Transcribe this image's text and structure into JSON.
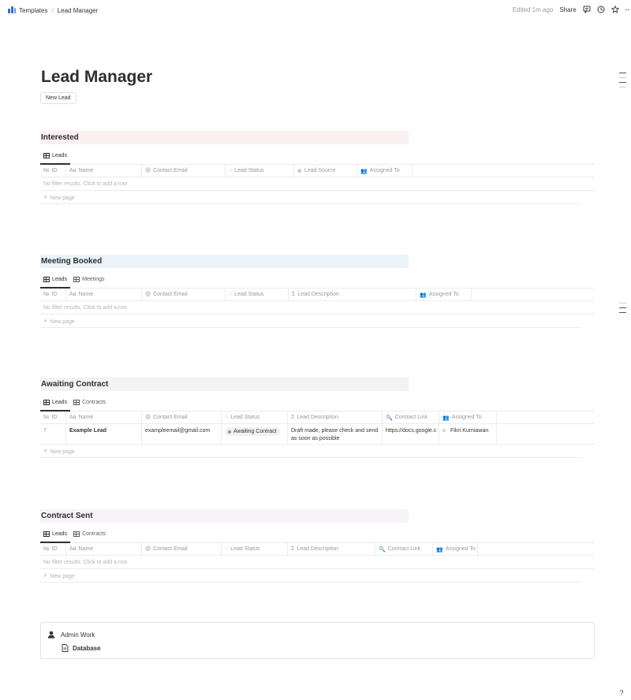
{
  "breadcrumb": {
    "root": "Templates",
    "separator": "/",
    "current": "Lead Manager"
  },
  "topbar": {
    "edited": "Edited 1m ago",
    "share": "Share",
    "more": "··"
  },
  "page": {
    "title": "Lead Manager",
    "new_button": "New Lead"
  },
  "sections": [
    {
      "title": "Interested",
      "color": "#fbf0f1",
      "tabs": [
        "Leads"
      ],
      "columns": [
        {
          "icon": "№",
          "label": "ID"
        },
        {
          "icon": "Aa",
          "label": "Name"
        },
        {
          "icon": "@",
          "label": "Contact Email"
        },
        {
          "icon": "◌",
          "label": "Lead Status"
        },
        {
          "icon": "⊕",
          "label": "Lead Source"
        },
        {
          "icon": "👥",
          "label": "Assigned To"
        }
      ],
      "empty_text": "No filter results. Click to add a row",
      "new_page": "New page"
    },
    {
      "title": "Meeting Booked",
      "color": "#e9f3f8",
      "tabs": [
        "Leads",
        "Meetings"
      ],
      "columns": [
        {
          "icon": "№",
          "label": "ID"
        },
        {
          "icon": "Aa",
          "label": "Name"
        },
        {
          "icon": "@",
          "label": "Contact Email"
        },
        {
          "icon": "◌",
          "label": "Lead Status"
        },
        {
          "icon": "Σ",
          "label": "Lead Description"
        },
        {
          "icon": "👥",
          "label": "Assigned To"
        }
      ],
      "empty_text": "No filter results. Click to add a row",
      "new_page": "New page"
    },
    {
      "title": "Awaiting Contract",
      "color": "#f4f3f2",
      "tabs": [
        "Leads",
        "Contracts"
      ],
      "columns": [
        {
          "icon": "№",
          "label": "ID"
        },
        {
          "icon": "Aa",
          "label": "Name"
        },
        {
          "icon": "@",
          "label": "Contact Email"
        },
        {
          "icon": "◌",
          "label": "Lead Status"
        },
        {
          "icon": "Σ",
          "label": "Lead Description"
        },
        {
          "icon": "🔍",
          "label": "Contract Link"
        },
        {
          "icon": "👥",
          "label": "Assigned To"
        }
      ],
      "rows": [
        {
          "id": "7",
          "name": "Example Lead",
          "email": "exampleemail@gmail.com",
          "status": "Awaiting Contract",
          "description": "Draft made, please check and send as soon as possible",
          "link": "https://docs.google.c",
          "assigned": "Fikri Kurniawan"
        }
      ],
      "new_page": "New page"
    },
    {
      "title": "Contract Sent",
      "color": "#f7f3f8",
      "tabs": [
        "Leads",
        "Contracts"
      ],
      "columns": [
        {
          "icon": "№",
          "label": "ID"
        },
        {
          "icon": "Aa",
          "label": "Name"
        },
        {
          "icon": "@",
          "label": "Contact Email"
        },
        {
          "icon": "◌",
          "label": "Lead Status"
        },
        {
          "icon": "Σ",
          "label": "Lead Description"
        },
        {
          "icon": "🔍",
          "label": "Contract Link"
        },
        {
          "icon": "👥",
          "label": "Assigned To"
        }
      ],
      "empty_text": "No filter results. Click to add a row",
      "new_page": "New page"
    }
  ],
  "admin": {
    "title": "Admin Work",
    "link": "Database"
  },
  "help": "?"
}
